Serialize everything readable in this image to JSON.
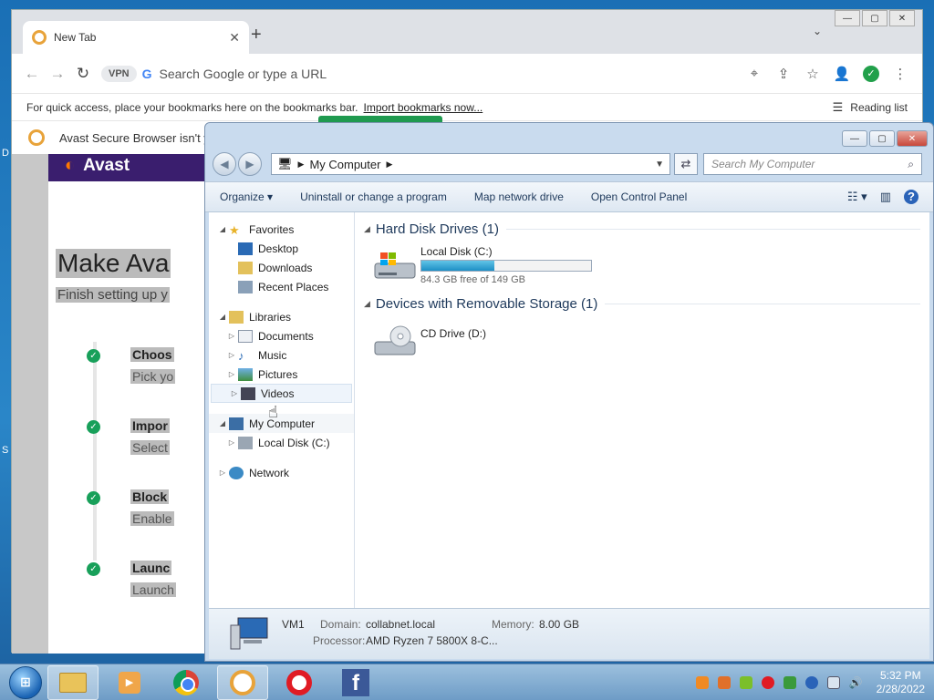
{
  "desktop": {
    "edge_letters": [
      "D",
      "S"
    ]
  },
  "chrome": {
    "tab_title": "New Tab",
    "vpn_label": "VPN",
    "omnibox_placeholder": "Search Google or type a URL",
    "bookmarks_hint": "For quick access, place your bookmarks here on the bookmarks bar.",
    "import_link": "Import bookmarks now...",
    "reading_list": "Reading list",
    "avast_banner": "Avast Secure Browser isn't y"
  },
  "avast_page": {
    "brand": "Avast",
    "title": "Make Ava",
    "subtitle": "Finish setting up y",
    "steps": [
      {
        "title": "Choos",
        "desc": "Pick yo"
      },
      {
        "title": "Impor",
        "desc": "Select"
      },
      {
        "title": "Block",
        "desc": "Enable"
      },
      {
        "title": "Launc",
        "desc": "Launch"
      }
    ]
  },
  "explorer": {
    "address": "My Computer",
    "search_placeholder": "Search My Computer",
    "commands": [
      "Organize",
      "Uninstall or change a program",
      "Map network drive",
      "Open Control Panel"
    ],
    "nav": {
      "favorites": "Favorites",
      "favorites_items": [
        "Desktop",
        "Downloads",
        "Recent Places"
      ],
      "libraries": "Libraries",
      "libraries_items": [
        "Documents",
        "Music",
        "Pictures",
        "Videos"
      ],
      "computer": "My Computer",
      "computer_items": [
        "Local Disk (C:)"
      ],
      "network": "Network"
    },
    "groups": {
      "hdd_header": "Hard Disk Drives (1)",
      "removable_header": "Devices with Removable Storage (1)"
    },
    "drives": {
      "c_name": "Local Disk (C:)",
      "c_free_text": "84.3 GB free of 149 GB",
      "c_used_fraction": 0.43,
      "d_name": "CD Drive (D:)"
    },
    "status": {
      "computer_name": "VM1",
      "domain_label": "Domain:",
      "domain_value": "collabnet.local",
      "memory_label": "Memory:",
      "memory_value": "8.00 GB",
      "processor_label": "Processor:",
      "processor_value": "AMD Ryzen 7 5800X 8-C..."
    }
  },
  "taskbar": {
    "time": "5:32 PM",
    "date": "2/28/2022"
  },
  "colors": {
    "explorer_frame": "#c9dbee",
    "avast_purple": "#3a1e6e",
    "check_green": "#18a05a",
    "disk_bar": "#1d8fc5"
  }
}
